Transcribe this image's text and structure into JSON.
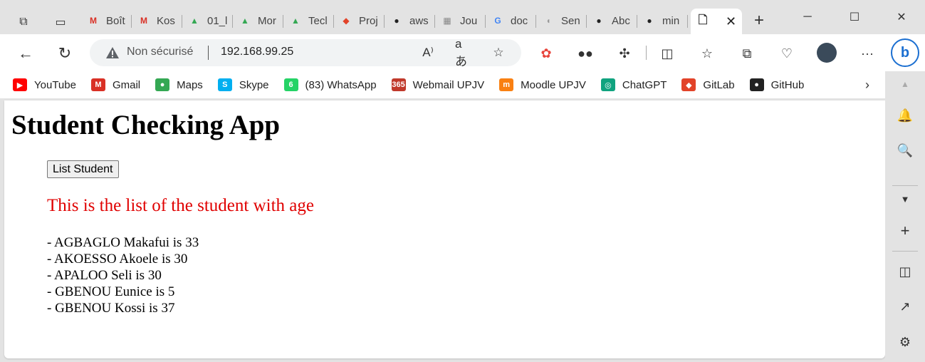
{
  "tabs": [
    {
      "title": "Boît",
      "icon": "gmail-icon",
      "color": "#d93025",
      "glyph": "M"
    },
    {
      "title": "Kos",
      "icon": "gmail-icon",
      "color": "#d93025",
      "glyph": "M"
    },
    {
      "title": "01_l",
      "icon": "google-drive-icon",
      "color": "#34a853",
      "glyph": "▲"
    },
    {
      "title": "Mor",
      "icon": "google-drive-icon",
      "color": "#34a853",
      "glyph": "▲"
    },
    {
      "title": "Tecl",
      "icon": "google-drive-icon",
      "color": "#34a853",
      "glyph": "▲"
    },
    {
      "title": "Proj",
      "icon": "gitlab-icon",
      "color": "#e24329",
      "glyph": "◆"
    },
    {
      "title": "aws",
      "icon": "github-icon",
      "color": "#222222",
      "glyph": "●"
    },
    {
      "title": "Jou",
      "icon": "page-icon",
      "color": "#888888",
      "glyph": "▦"
    },
    {
      "title": "doc",
      "icon": "google-icon",
      "color": "#4285f4",
      "glyph": "G"
    },
    {
      "title": "Sen",
      "icon": "docker-icon",
      "color": "#999999",
      "glyph": "◖"
    },
    {
      "title": "Abc",
      "icon": "github-icon",
      "color": "#222222",
      "glyph": "●"
    },
    {
      "title": "min",
      "icon": "github-icon",
      "color": "#222222",
      "glyph": "●"
    }
  ],
  "active_tab": {
    "close_glyph": "✕"
  },
  "address": {
    "security_label": "Non sécurisé",
    "url": "192.168.99.25"
  },
  "bookmarks": [
    {
      "label": "YouTube",
      "icon": "youtube-icon",
      "color": "#ff0000",
      "glyph": "▶"
    },
    {
      "label": "Gmail",
      "icon": "gmail-icon",
      "color": "#d93025",
      "glyph": "M"
    },
    {
      "label": "Maps",
      "icon": "maps-icon",
      "color": "#34a853",
      "glyph": "●"
    },
    {
      "label": "Skype",
      "icon": "skype-icon",
      "color": "#00aff0",
      "glyph": "S"
    },
    {
      "label": "(83) WhatsApp",
      "icon": "whatsapp-icon",
      "color": "#25d366",
      "glyph": "6"
    },
    {
      "label": "Webmail UPJV",
      "icon": "webmail-icon",
      "color": "#c0392b",
      "glyph": "365"
    },
    {
      "label": "Moodle UPJV",
      "icon": "moodle-icon",
      "color": "#f98012",
      "glyph": "m"
    },
    {
      "label": "ChatGPT",
      "icon": "chatgpt-icon",
      "color": "#10a37f",
      "glyph": "◎"
    },
    {
      "label": "GitLab",
      "icon": "gitlab-icon",
      "color": "#e24329",
      "glyph": "◆"
    },
    {
      "label": "GitHub",
      "icon": "github-icon",
      "color": "#222222",
      "glyph": "●"
    }
  ],
  "page": {
    "title": "Student Checking App",
    "button_label": "List Student",
    "caption": "This is the list of the student with age",
    "caption_color": "#e00000",
    "students": [
      "- AGBAGLO Makafui is 33",
      "- AKOESSO Akoele is 30",
      "- APALOO Seli is 30",
      "- GBENOU Eunice is 5",
      "- GBENOU Kossi is 37"
    ]
  }
}
